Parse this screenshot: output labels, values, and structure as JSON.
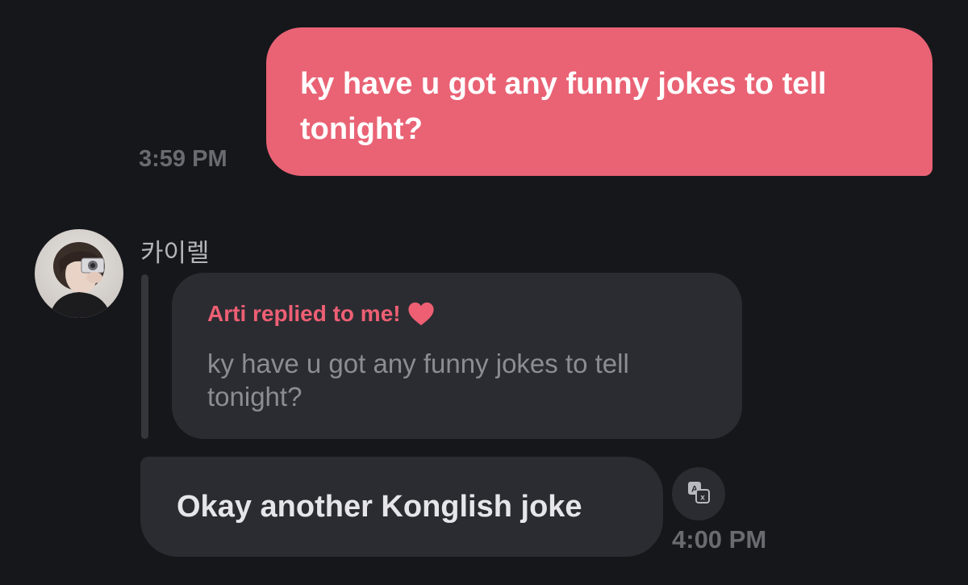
{
  "messages": {
    "outgoing": {
      "text": "ky have u got any funny jokes to tell tonight?",
      "time": "3:59 PM",
      "bubble_color": "#e96375"
    },
    "incoming": {
      "sender": "카이렐",
      "reply": {
        "header": "Arti replied to me!",
        "header_icon": "heart-icon",
        "quoted_text": "ky have u got any funny jokes to tell tonight?"
      },
      "text": "Okay another Konglish joke",
      "time": "4:00 PM",
      "translate_icon": "translate-icon"
    }
  },
  "colors": {
    "background": "#16171b",
    "bubble_incoming": "#2b2c31",
    "accent": "#ee5f74",
    "timestamp": "#6a6b71"
  }
}
